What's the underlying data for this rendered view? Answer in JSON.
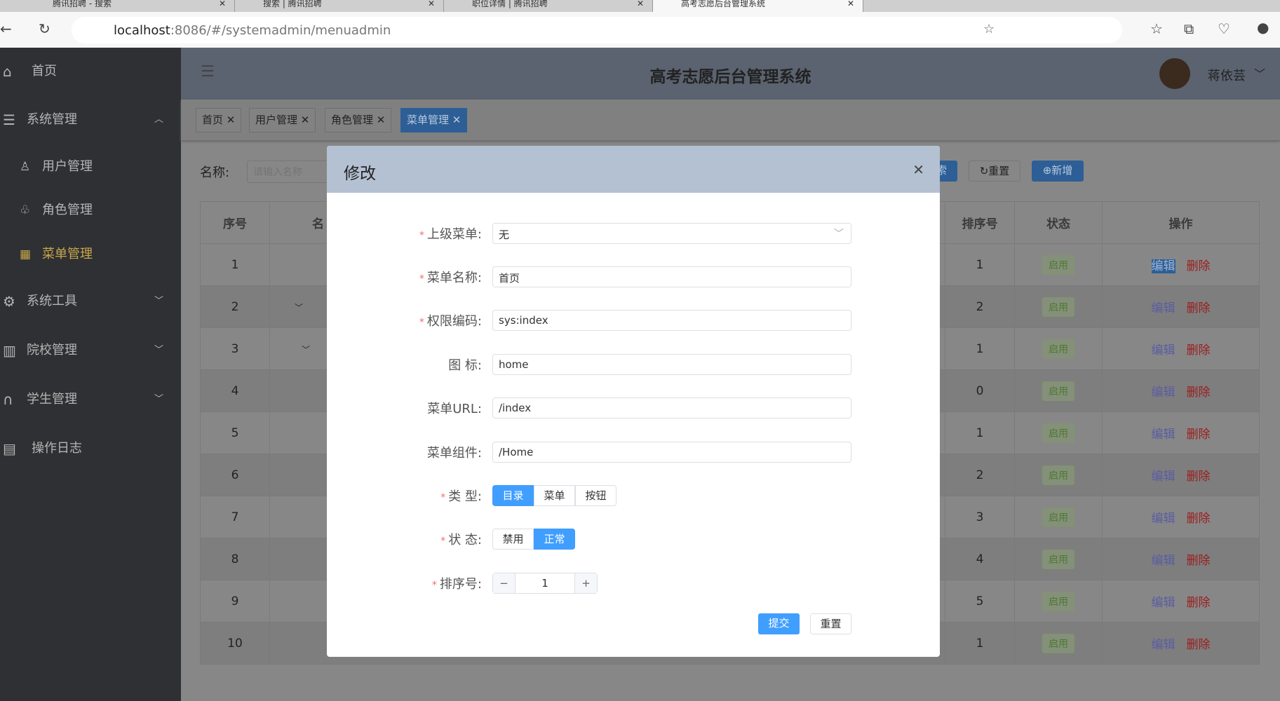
{
  "browser": {
    "tabs": [
      {
        "title": "腾讯招聘 - 搜索"
      },
      {
        "title": "搜索 | 腾讯招聘"
      },
      {
        "title": "职位详情 | 腾讯招聘"
      },
      {
        "title": "高考志愿后台管理系统"
      }
    ],
    "url_host": "localhost",
    "url_rest": ":8086/#/systemadmin/menuadmin"
  },
  "sidebar": {
    "items": [
      {
        "label": "首页",
        "icon": "home-icon"
      },
      {
        "label": "系统管理",
        "icon": "sliders-icon",
        "expanded": true
      },
      {
        "label": "用户管理",
        "icon": "user-icon"
      },
      {
        "label": "角色管理",
        "icon": "users-icon"
      },
      {
        "label": "菜单管理",
        "icon": "grid-icon",
        "active": true
      },
      {
        "label": "系统工具",
        "icon": "gear-icon"
      },
      {
        "label": "院校管理",
        "icon": "building-icon"
      },
      {
        "label": "学生管理",
        "icon": "headset-icon"
      },
      {
        "label": "操作日志",
        "icon": "log-icon"
      }
    ]
  },
  "header": {
    "title": "高考志愿后台管理系统",
    "user": "蒋依芸"
  },
  "tags": [
    {
      "label": "首页"
    },
    {
      "label": "用户管理"
    },
    {
      "label": "角色管理"
    },
    {
      "label": "菜单管理",
      "active": true
    }
  ],
  "search": {
    "label": "名称:",
    "placeholder": "请输入名称",
    "search_btn": "索",
    "reset_btn": "重置",
    "add_btn": "新增"
  },
  "table": {
    "headers": {
      "index": "序号",
      "name": "名",
      "sort": "排序号",
      "status": "状态",
      "ops": "操作"
    },
    "rows": [
      {
        "i": "1",
        "s": "1"
      },
      {
        "i": "2",
        "s": "2"
      },
      {
        "i": "3",
        "s": "1"
      },
      {
        "i": "4",
        "s": "0"
      },
      {
        "i": "5",
        "s": "1"
      },
      {
        "i": "6",
        "s": "2"
      },
      {
        "i": "7",
        "s": "3"
      },
      {
        "i": "8",
        "s": "4"
      },
      {
        "i": "9",
        "s": "5"
      },
      {
        "i": "10",
        "s": "1"
      }
    ],
    "status_label": "启用",
    "edit": "编辑",
    "delete": "删除"
  },
  "dialog": {
    "title": "修改",
    "fields": {
      "parent": {
        "label": "上级菜单:",
        "value": "无"
      },
      "name": {
        "label": "菜单名称:",
        "value": "首页"
      },
      "perm": {
        "label": "权限编码:",
        "value": "sys:index"
      },
      "icon": {
        "label": "图 标:",
        "value": "home"
      },
      "url": {
        "label": "菜单URL:",
        "value": "/index"
      },
      "component": {
        "label": "菜单组件:",
        "value": "/Home"
      }
    },
    "type": {
      "label": "类 型:",
      "options": [
        "目录",
        "菜单",
        "按钮"
      ],
      "selected": "目录"
    },
    "status": {
      "label": "状 态:",
      "options": [
        "禁用",
        "正常"
      ],
      "selected": "正常"
    },
    "sort": {
      "label": "排序号:",
      "value": "1"
    },
    "submit": "提交",
    "reset": "重置"
  }
}
